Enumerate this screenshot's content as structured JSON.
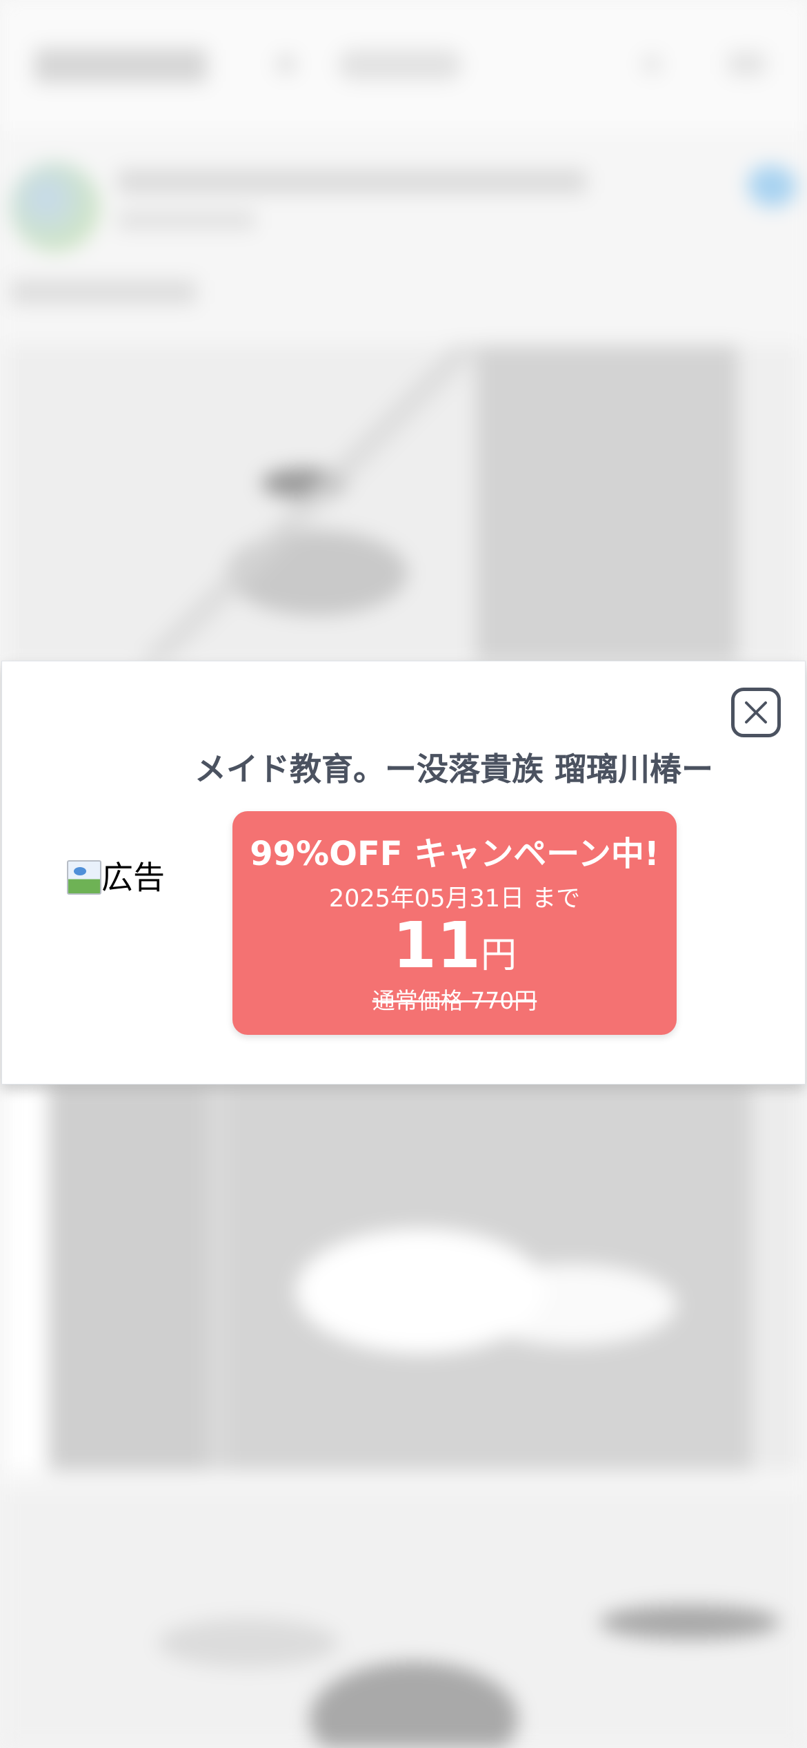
{
  "ad": {
    "title": "メイド教育。ー没落貴族 瑠璃川椿ー",
    "image_alt": "広告",
    "campaign": "99%OFF キャンペーン中!",
    "deadline": "2025年05月31日 まで",
    "sale_price": "11",
    "sale_price_unit": "円",
    "regular_price": "通常価格 770円"
  },
  "colors": {
    "price_card": "#f47272",
    "title_text": "#4b5260",
    "close_border": "#4b5260"
  },
  "icons": {
    "close": "close-icon",
    "broken_image": "broken-image-icon"
  }
}
